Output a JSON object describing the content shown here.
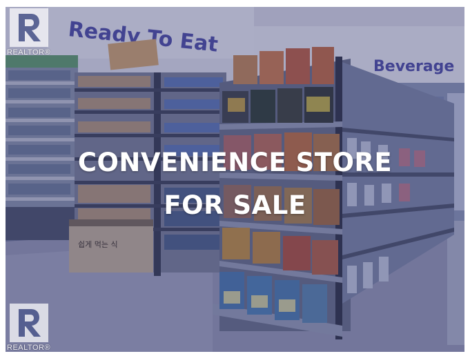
{
  "photo": {
    "headline_line1": "CONVENIENCE STORE",
    "headline_line2": "FOR SALE",
    "sign_ready_to_eat": "Ready To Eat",
    "sign_beverage": "Beverage",
    "display_table_label": "쉽게 먹는 식",
    "watermark_text": "REALTOR®",
    "watermark_icon": "realtor-r-logo-icon",
    "overlay_color": "#343a6e"
  }
}
